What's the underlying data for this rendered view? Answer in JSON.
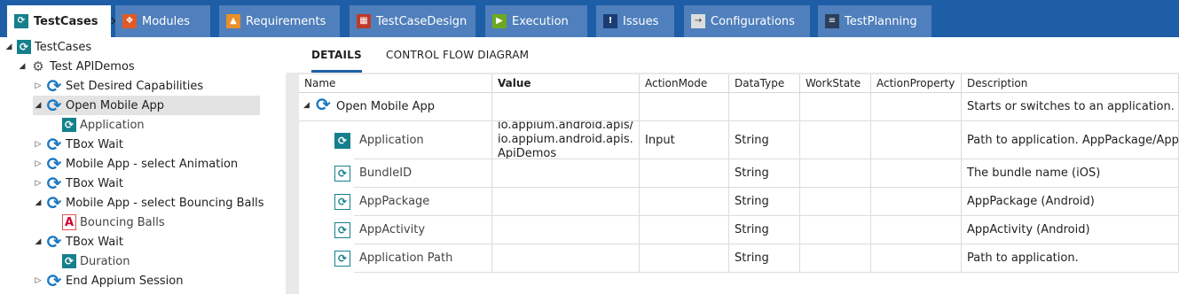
{
  "tabs": [
    {
      "label": "TestCases",
      "icon": "testcase-icon",
      "active": true,
      "close": "×"
    },
    {
      "label": "Modules",
      "icon": "modules-icon"
    },
    {
      "label": "Requirements",
      "icon": "requirements-icon"
    },
    {
      "label": "TestCaseDesign",
      "icon": "testcasedesign-icon"
    },
    {
      "label": "Execution",
      "icon": "execution-icon"
    },
    {
      "label": "Issues",
      "icon": "issues-icon"
    },
    {
      "label": "Configurations",
      "icon": "configurations-icon"
    },
    {
      "label": "TestPlanning",
      "icon": "testplanning-icon"
    }
  ],
  "tree": [
    {
      "label": "TestCases",
      "expander": "◢",
      "icon": "testcase-folder-icon"
    },
    {
      "label": "Test APIDemos",
      "expander": "◢",
      "icon": "test-case-icon"
    },
    {
      "label": "Set Desired Capabilities",
      "expander": "▷",
      "icon": "reuse-cycle-icon"
    },
    {
      "label": "Open Mobile App",
      "expander": "◢",
      "icon": "reuse-cycle-icon",
      "selected": true
    },
    {
      "label": "Application",
      "expander": "",
      "icon": "testcase-step-icon"
    },
    {
      "label": "TBox Wait",
      "expander": "▷",
      "icon": "reuse-cycle-icon"
    },
    {
      "label": "Mobile App - select Animation",
      "expander": "▷",
      "icon": "reuse-cycle-icon"
    },
    {
      "label": "TBox Wait",
      "expander": "▷",
      "icon": "reuse-cycle-icon"
    },
    {
      "label": "Mobile App - select Bouncing Balls",
      "expander": "◢",
      "icon": "reuse-cycle-icon"
    },
    {
      "label": "Bouncing Balls",
      "expander": "",
      "icon": "image-step-icon"
    },
    {
      "label": "TBox Wait",
      "expander": "◢",
      "icon": "reuse-cycle-icon"
    },
    {
      "label": "Duration",
      "expander": "",
      "icon": "testcase-step-icon"
    },
    {
      "label": "End Appium Session",
      "expander": "▷",
      "icon": "reuse-cycle-icon"
    }
  ],
  "subtabs": [
    {
      "label": "DETAILS",
      "active": true
    },
    {
      "label": "CONTROL FLOW DIAGRAM"
    }
  ],
  "columns": [
    "Name",
    "Value",
    "ActionMode",
    "DataType",
    "WorkState",
    "ActionProperty",
    "Description"
  ],
  "rows": [
    {
      "name": "Open Mobile App",
      "value": "",
      "actionMode": "",
      "dataType": "",
      "workState": "",
      "actionProperty": "",
      "description": "Starts or switches to an application.",
      "kind": "parent",
      "expander": "◢"
    },
    {
      "name": "Application",
      "value": "io.appium.android.apis/ io.appium.android.apis. ApiDemos",
      "actionMode": "Input",
      "dataType": "String",
      "workState": "",
      "actionProperty": "",
      "description": "Path to application. AppPackage/App...",
      "kind": "filled"
    },
    {
      "name": "BundleID",
      "value": "",
      "actionMode": "",
      "dataType": "String",
      "workState": "",
      "actionProperty": "",
      "description": "The bundle name (iOS)",
      "kind": "outline"
    },
    {
      "name": "AppPackage",
      "value": "",
      "actionMode": "",
      "dataType": "String",
      "workState": "",
      "actionProperty": "",
      "description": "AppPackage (Android)",
      "kind": "outline"
    },
    {
      "name": "AppActivity",
      "value": "",
      "actionMode": "",
      "dataType": "String",
      "workState": "",
      "actionProperty": "",
      "description": " AppActivity (Android)",
      "kind": "outline"
    },
    {
      "name": "Application Path",
      "value": "",
      "actionMode": "",
      "dataType": "String",
      "workState": "",
      "actionProperty": "",
      "description": "Path to application.",
      "kind": "outline"
    }
  ]
}
